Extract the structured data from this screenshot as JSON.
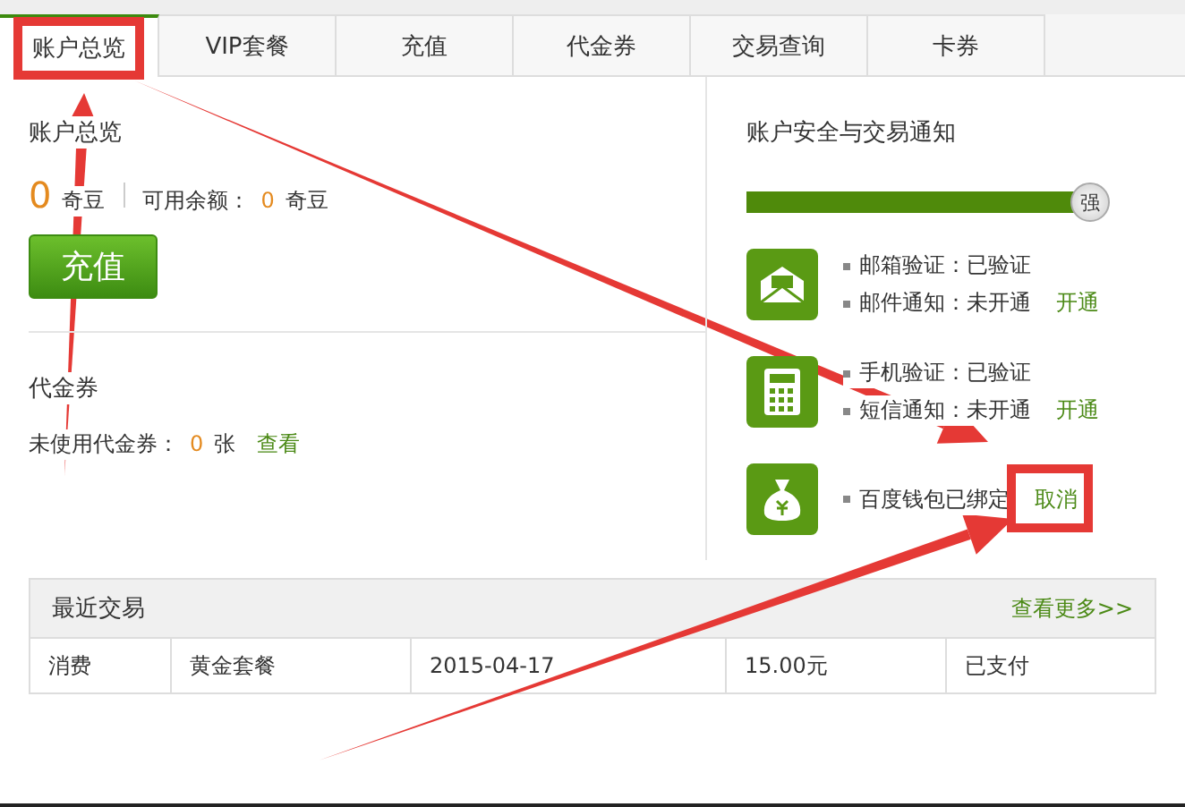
{
  "tabs": [
    {
      "label": "账户总览",
      "selected": true
    },
    {
      "label": "VIP套餐",
      "selected": false
    },
    {
      "label": "充值",
      "selected": false
    },
    {
      "label": "代金券",
      "selected": false
    },
    {
      "label": "交易查询",
      "selected": false
    },
    {
      "label": "卡券",
      "selected": false
    }
  ],
  "overview": {
    "title": "账户总览",
    "balance": "0",
    "balance_unit": "奇豆",
    "available_label": "可用余额：",
    "available": "0",
    "available_unit": "奇豆",
    "recharge_button": "充值"
  },
  "coupons": {
    "title": "代金券",
    "label": "未使用代金券：",
    "count": "0",
    "unit": "张",
    "link": "查看"
  },
  "security": {
    "title": "账户安全与交易通知",
    "level": 0.96,
    "strength": "强",
    "items": [
      {
        "kind": "mail",
        "lines": [
          {
            "text": "邮箱验证：已验证"
          },
          {
            "text": "邮件通知：未开通",
            "action": "开通"
          }
        ]
      },
      {
        "kind": "phone",
        "lines": [
          {
            "text": "手机验证：已验证"
          },
          {
            "text": "短信通知：未开通",
            "action": "开通"
          }
        ]
      },
      {
        "kind": "wallet",
        "lines": [
          {
            "text": "百度钱包已绑定",
            "action": "取消"
          }
        ]
      }
    ]
  },
  "recent": {
    "title": "最近交易",
    "more": "查看更多>>",
    "rows": [
      [
        "消费",
        "黄金套餐",
        "2015-04-17",
        "15.00元",
        "已支付"
      ]
    ]
  }
}
